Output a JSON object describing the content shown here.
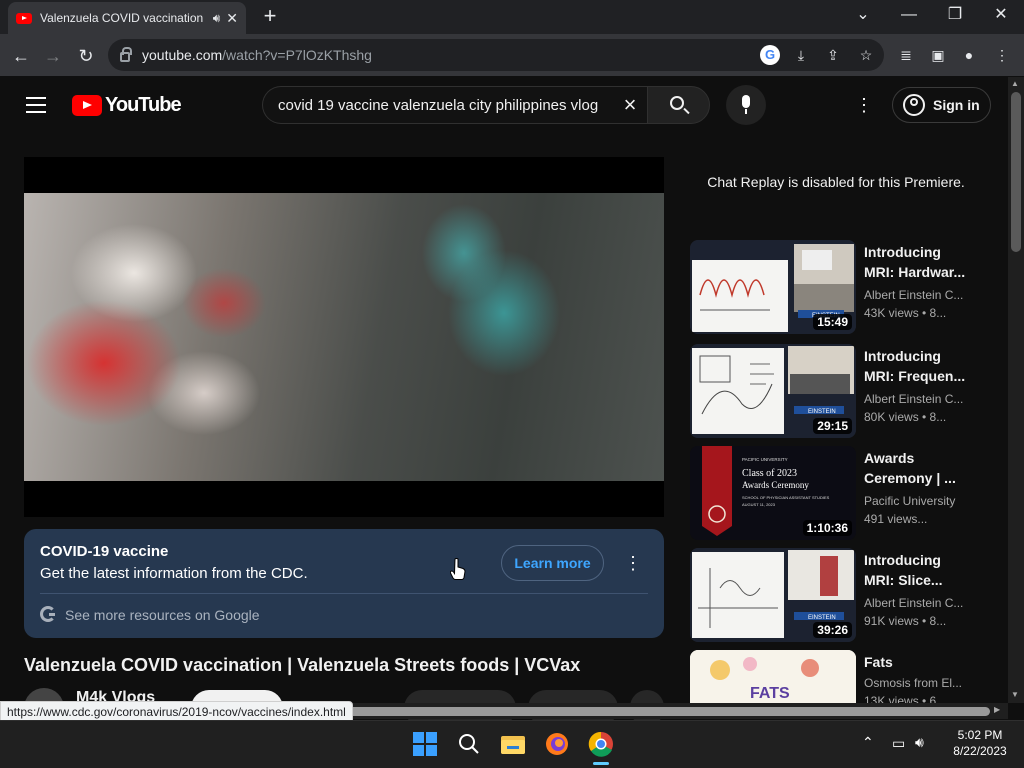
{
  "browser": {
    "tab_title": "Valenzuela COVID vaccination",
    "url_host": "youtube.com",
    "url_path": "/watch?v=P7lOzKThshg",
    "status_url": "https://www.cdc.gov/coronavirus/2019-ncov/vaccines/index.html"
  },
  "youtube": {
    "logo_text": "YouTube",
    "search_query": "covid 19 vaccine valenzuela city philippines vlog",
    "signin_label": "Sign in"
  },
  "cdc_panel": {
    "heading": "COVID-19 vaccine",
    "subtext": "Get the latest information from the CDC.",
    "button_label": "Learn more",
    "more_resources": "See more resources on Google"
  },
  "video": {
    "title": "Valenzuela COVID vaccination | Valenzuela Streets foods | VCVax",
    "channel": "M4k Vlogs"
  },
  "sidebar": {
    "chat_replay": "Chat Replay is disabled for this Premiere.",
    "recommendations": [
      {
        "title": "Introducing MRI: Hardwar...",
        "channel": "Albert Einstein C...",
        "meta": "43K views • 8...",
        "duration": "15:49"
      },
      {
        "title": "Introducing MRI: Frequen...",
        "channel": "Albert Einstein C...",
        "meta": "80K views • 8...",
        "duration": "29:15"
      },
      {
        "title": "Awards Ceremony | ...",
        "channel": "Pacific University",
        "meta": "491 views...",
        "duration": "1:10:36"
      },
      {
        "title": "Introducing MRI: Slice...",
        "channel": "Albert Einstein C...",
        "meta": "91K views • 8...",
        "duration": "39:26"
      },
      {
        "title": "Fats",
        "channel": "Osmosis from El...",
        "meta": "13K views • 6...",
        "duration": ""
      }
    ],
    "pacific_thumb": {
      "line1": "PACIFIC UNIVERSITY",
      "line2": "Class of 2023",
      "line3": "Awards Ceremony",
      "line4": "SCHOOL OF PHYSICIAN ASSISTANT STUDIES",
      "line5": "AUGUST 11, 2023"
    },
    "fats_thumb_text": "FATS",
    "einstein_badge": "EINSTEIN"
  },
  "taskbar": {
    "time": "5:02 PM",
    "date": "8/22/2023"
  },
  "colors": {
    "youtube_red": "#ff0000",
    "link_blue": "#3ea6ff",
    "cdc_panel_bg": "#263850"
  }
}
